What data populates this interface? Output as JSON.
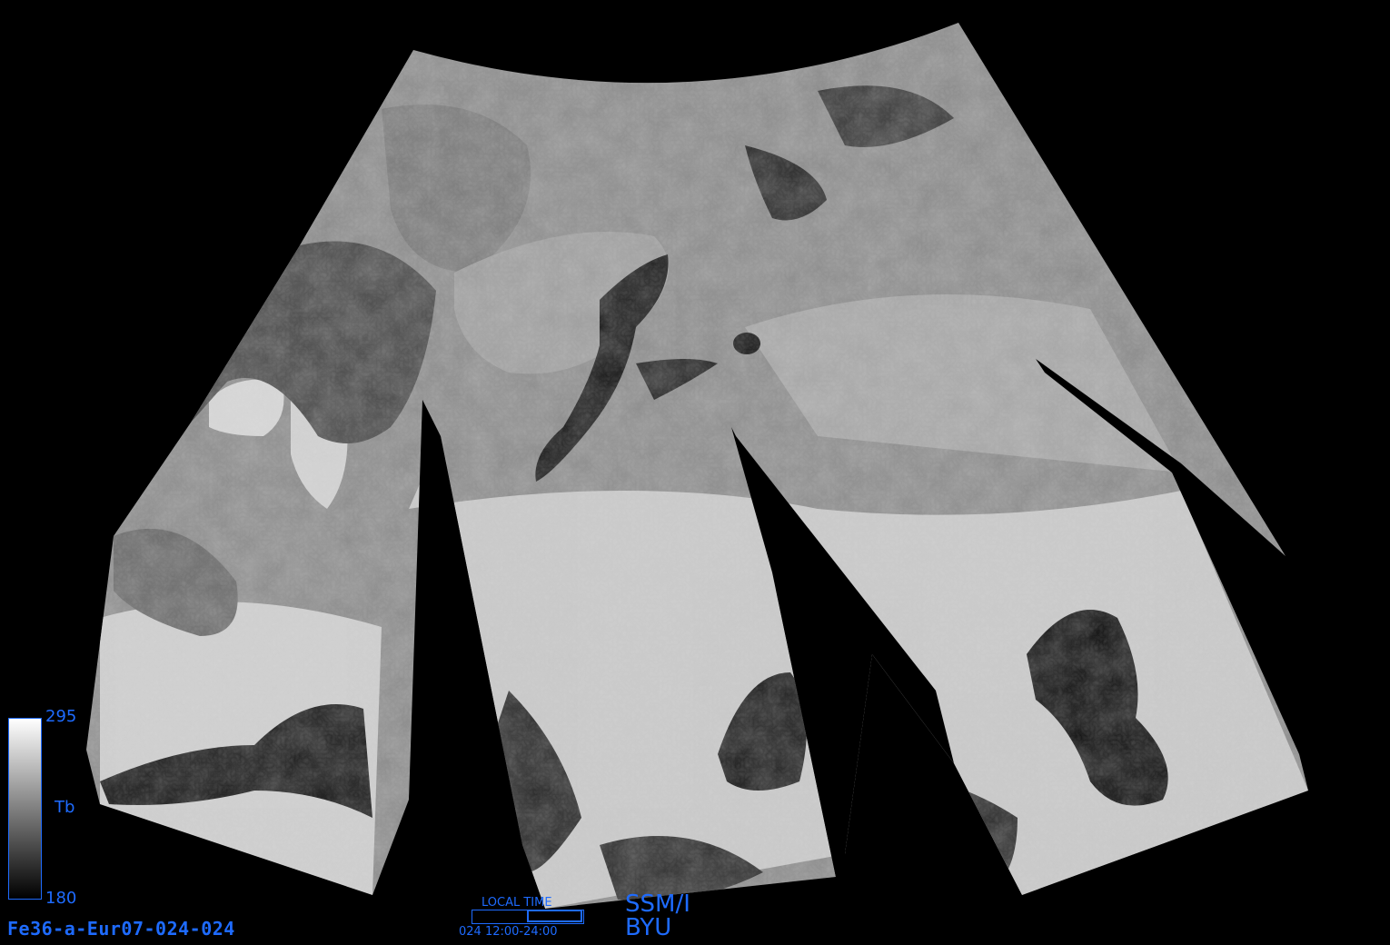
{
  "product": {
    "filename": "Fe36-a-Eur07-024-024",
    "sensor": "SSM/I",
    "organization": "BYU"
  },
  "colorbar": {
    "max_label": "295",
    "min_label": "180",
    "unit_label": "Tb",
    "max_color": "#ffffff",
    "min_color": "#000000"
  },
  "local_time": {
    "label": "LOCAL TIME",
    "range_label": "024 12:00-24:00",
    "fill_fraction": 0.5
  },
  "colors": {
    "annotation_blue": "#1e6bff",
    "background": "#000000"
  }
}
